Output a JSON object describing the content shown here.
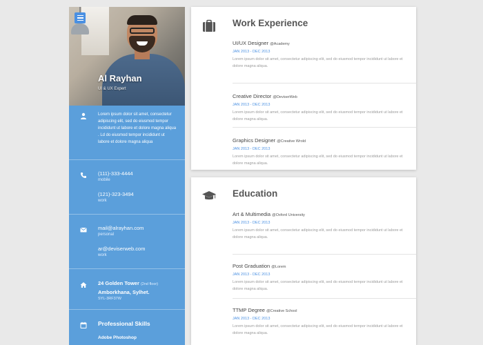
{
  "profile": {
    "name": "Al Rayhan",
    "title": "UI & UX Expert"
  },
  "sidebar": {
    "about": "Lorem ipsum dolor sit amet, consectetur adipiscing elit, sed do eiusmod tempor incididunt ut labore et dolore magna aliqua . Ld do eiusmod tempor incididunt ut labore et dolore magna aliqua",
    "phones": [
      {
        "value": "(111)-333-4444",
        "label": "mobile"
      },
      {
        "value": "(121)-323-3494",
        "label": "work"
      }
    ],
    "emails": [
      {
        "value": "mail@alrayhan.com",
        "label": "personal"
      },
      {
        "value": "ar@deviserweb.com",
        "label": "work"
      }
    ],
    "address": {
      "line1": "24 Golden Tower",
      "note": "(2nd floor)",
      "line2": "Amborkhana, Sylhet.",
      "zip": "SYL-3RF37W"
    },
    "skills": {
      "title": "Professional Skills",
      "items": [
        "Adobe Photoshop"
      ]
    }
  },
  "work": {
    "title": "Work Experience",
    "entries": [
      {
        "role": "UI/UX Designer",
        "at": "@Academy",
        "date": "JAN 2013 - DEC 2013",
        "desc": "Lorem ipsum dolor sit amet, consectetur adipiscing elit, sed do eiusmod tempor incididunt ut labore et dolore magna aliqua."
      },
      {
        "role": "Creative Director",
        "at": "@DeviserWeb",
        "date": "JAN 2013 - DEC 2013",
        "desc": "Lorem ipsum dolor sit amet, consectetur adipiscing elit, sed do eiusmod tempor incididunt ut labore et dolore magna aliqua."
      },
      {
        "role": "Graphics Designer",
        "at": "@Creative Wrold",
        "date": "JAN 2013 - DEC 2013",
        "desc": "Lorem ipsum dolor sit amet, consectetur adipiscing elit, sed do eiusmod tempor incididunt ut labore et dolore magna aliqua."
      }
    ]
  },
  "education": {
    "title": "Education",
    "entries": [
      {
        "role": "Art & Multimedia",
        "at": "@Oxford University",
        "date": "JAN 2013 - DEC 2013",
        "desc": "Lorem ipsum dolor sit amet, consectetur adipiscing elit, sed do eiusmod tempor incididunt ut labore et dolore magna aliqua."
      },
      {
        "role": "Post Graduation",
        "at": "@Lorem",
        "date": "JAN 2013 - DEC 2013",
        "desc": "Lorem ipsum dolor sit amet, consectetur adipiscing elit, sed do eiusmod tempor incididunt ut labore et dolore magna aliqua."
      },
      {
        "role": "TTMP Degree",
        "at": "@Creative School",
        "date": "JAN 2013 - DEC 2013",
        "desc": "Lorem ipsum dolor sit amet, consectetur adipiscing elit, sed do eiusmod tempor incididunt ut labore et dolore magna aliqua."
      }
    ]
  },
  "icons": {
    "menu": "menu-icon",
    "about": "user-icon",
    "phone": "phone-icon",
    "email": "envelope-icon",
    "address": "home-icon",
    "skills": "calendar-icon",
    "work": "briefcase-icon",
    "education": "graduation-cap-icon"
  },
  "colors": {
    "sidebar": "#5b9fdb",
    "accent": "#4a90e2",
    "background": "#e9e9e9"
  }
}
